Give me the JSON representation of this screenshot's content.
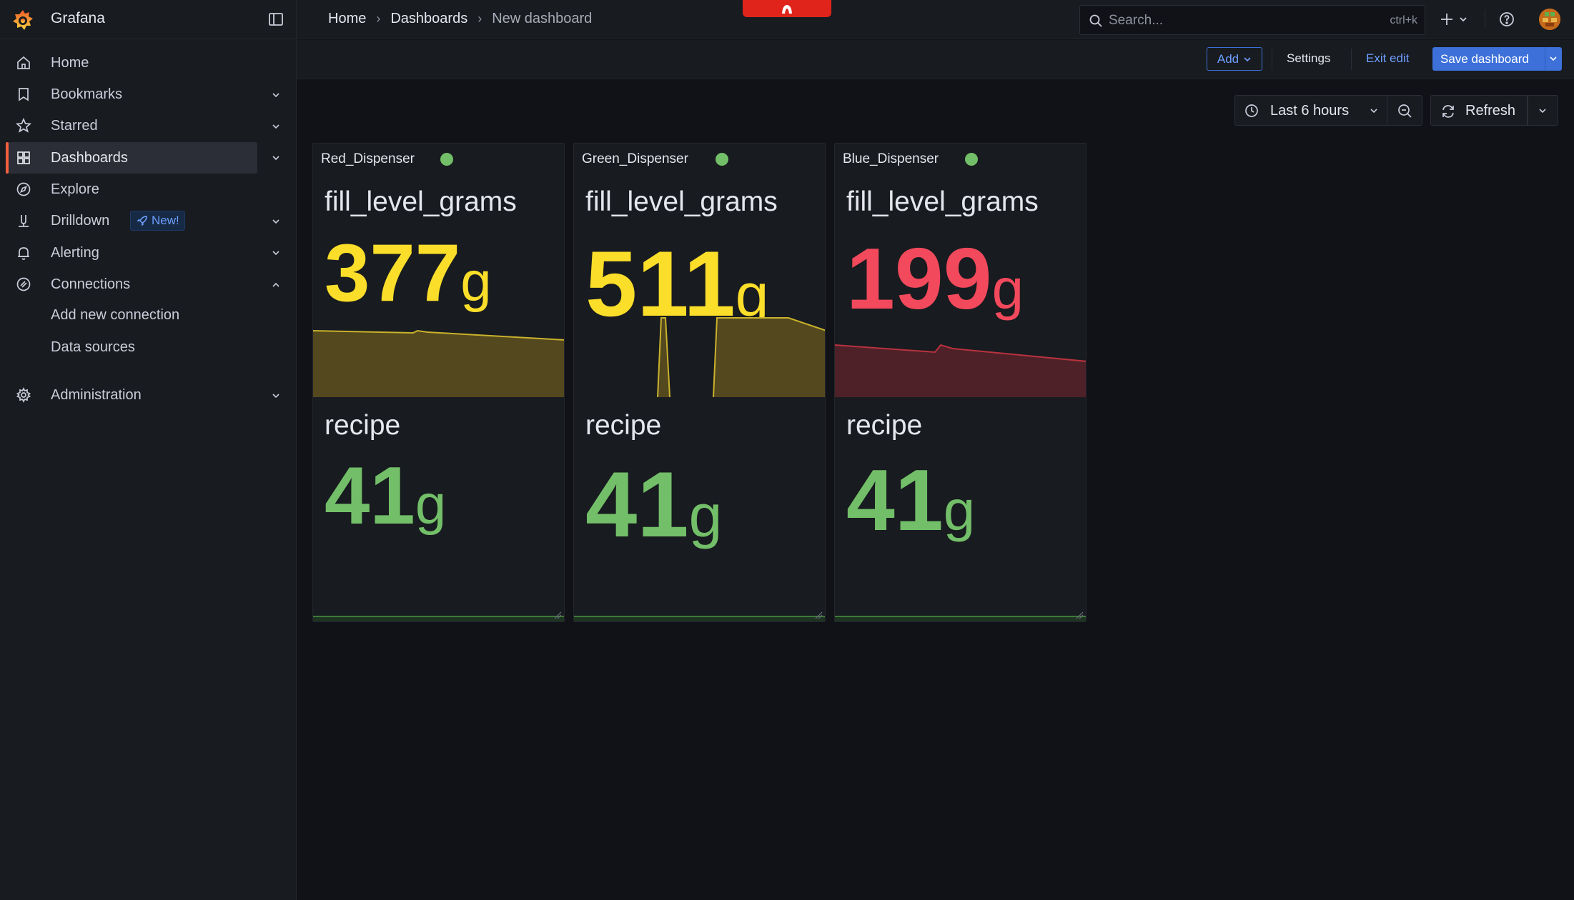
{
  "app": {
    "brand": "Grafana"
  },
  "breadcrumb": [
    "Home",
    "Dashboards",
    "New dashboard"
  ],
  "search": {
    "placeholder": "Search...",
    "shortcut": "ctrl+k"
  },
  "sidebar": {
    "items": [
      {
        "label": "Home",
        "icon": "home-icon"
      },
      {
        "label": "Bookmarks",
        "icon": "bookmark-icon"
      },
      {
        "label": "Starred",
        "icon": "star-icon"
      },
      {
        "label": "Dashboards",
        "icon": "apps-icon",
        "active": true
      },
      {
        "label": "Explore",
        "icon": "compass-icon"
      },
      {
        "label": "Drilldown",
        "icon": "drilldown-icon",
        "badge": "New!"
      },
      {
        "label": "Alerting",
        "icon": "bell-icon"
      },
      {
        "label": "Connections",
        "icon": "plug-icon",
        "expanded": true
      },
      {
        "label": "Administration",
        "icon": "cog-icon"
      }
    ],
    "sub_items": [
      "Add new connection",
      "Data sources"
    ]
  },
  "toolbar": {
    "add_label": "Add",
    "settings_label": "Settings",
    "exit_edit_label": "Exit edit",
    "save_label": "Save dashboard",
    "time_range": "Last 6 hours",
    "refresh_label": "Refresh"
  },
  "colors": {
    "accent": "#3d71d9",
    "yellow": "#fade2a",
    "red": "#f2495c",
    "green": "#73bf69",
    "brand_orange": "#f55f3e"
  },
  "panels": [
    {
      "title": "Red_Dispenser",
      "metric1": {
        "label": "fill_level_grams",
        "value": "377",
        "unit": "g",
        "color": "#fade2a"
      },
      "metric2": {
        "label": "recipe",
        "value": "41",
        "unit": "g",
        "color": "#73bf69"
      }
    },
    {
      "title": "Green_Dispenser",
      "metric1": {
        "label": "fill_level_grams",
        "value": "511",
        "unit": "g",
        "color": "#fade2a"
      },
      "metric2": {
        "label": "recipe",
        "value": "41",
        "unit": "g",
        "color": "#73bf69"
      }
    },
    {
      "title": "Blue_Dispenser",
      "metric1": {
        "label": "fill_level_grams",
        "value": "199",
        "unit": "g",
        "color": "#f2495c"
      },
      "metric2": {
        "label": "recipe",
        "value": "41",
        "unit": "g",
        "color": "#73bf69"
      }
    }
  ]
}
